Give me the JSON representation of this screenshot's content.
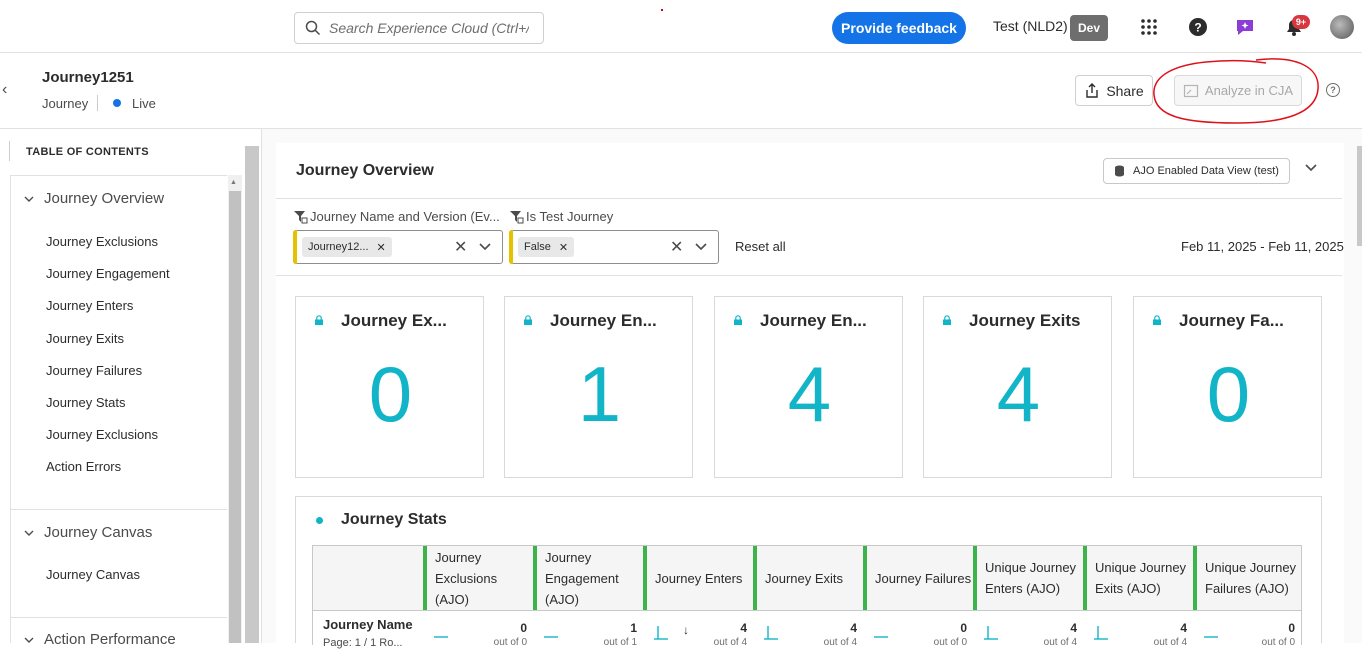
{
  "topbar": {
    "search_placeholder": "Search Experience Cloud (Ctrl+/)",
    "feedback_label": "Provide feedback",
    "org": "Test (NLD2)",
    "env": "Dev",
    "notifications_count": "9+"
  },
  "journey": {
    "title": "Journey1251",
    "type": "Journey",
    "status": "Live",
    "share_label": "Share",
    "analyze_label": "Analyze in CJA"
  },
  "toc": {
    "title": "TABLE OF CONTENTS",
    "sections": [
      {
        "label": "Journey Overview",
        "items": [
          "Journey Exclusions",
          "Journey Engagement",
          "Journey Enters",
          "Journey Exits",
          "Journey Failures",
          "Journey Stats",
          "Journey Exclusions",
          "Action Errors"
        ]
      },
      {
        "label": "Journey Canvas",
        "items": [
          "Journey Canvas"
        ]
      },
      {
        "label": "Action Performance",
        "items": []
      }
    ]
  },
  "overview": {
    "title": "Journey Overview",
    "dataview": "AJO Enabled Data View (test)",
    "filters": [
      {
        "label": "Journey Name and Version (Ev...",
        "chip": "Journey12..."
      },
      {
        "label": "Is Test Journey",
        "chip": "False"
      }
    ],
    "reset_label": "Reset all",
    "date_range": "Feb 11, 2025 - Feb 11, 2025"
  },
  "cards": [
    {
      "title": "Journey Ex...",
      "value": "0"
    },
    {
      "title": "Journey En...",
      "value": "1"
    },
    {
      "title": "Journey En...",
      "value": "4"
    },
    {
      "title": "Journey Exits",
      "value": "4"
    },
    {
      "title": "Journey Fa...",
      "value": "0"
    }
  ],
  "stats": {
    "title": "Journey Stats",
    "row_header": "Journey Name",
    "row_sub": "Page: 1 / 1 Ro...",
    "columns": [
      {
        "label": "Journey Exclusions (AJO)",
        "value": "0",
        "of": "out of 0"
      },
      {
        "label": "Journey Engagement (AJO)",
        "value": "1",
        "of": "out of 1"
      },
      {
        "label": "Journey Enters",
        "value": "4",
        "of": "out of 4"
      },
      {
        "label": "Journey Exits",
        "value": "4",
        "of": "out of 4"
      },
      {
        "label": "Journey Failures",
        "value": "0",
        "of": "out of 0"
      },
      {
        "label": "Unique Journey Enters (AJO)",
        "value": "4",
        "of": "out of 4"
      },
      {
        "label": "Unique Journey Exits (AJO)",
        "value": "4",
        "of": "out of 4"
      },
      {
        "label": "Unique Journey Failures (AJO)",
        "value": "0",
        "of": "out of 0"
      }
    ]
  },
  "colors": {
    "accent": "#1473e6",
    "metric": "#12b5c8",
    "column_marker": "#3cb44b",
    "filter_marker": "#e6c100"
  }
}
